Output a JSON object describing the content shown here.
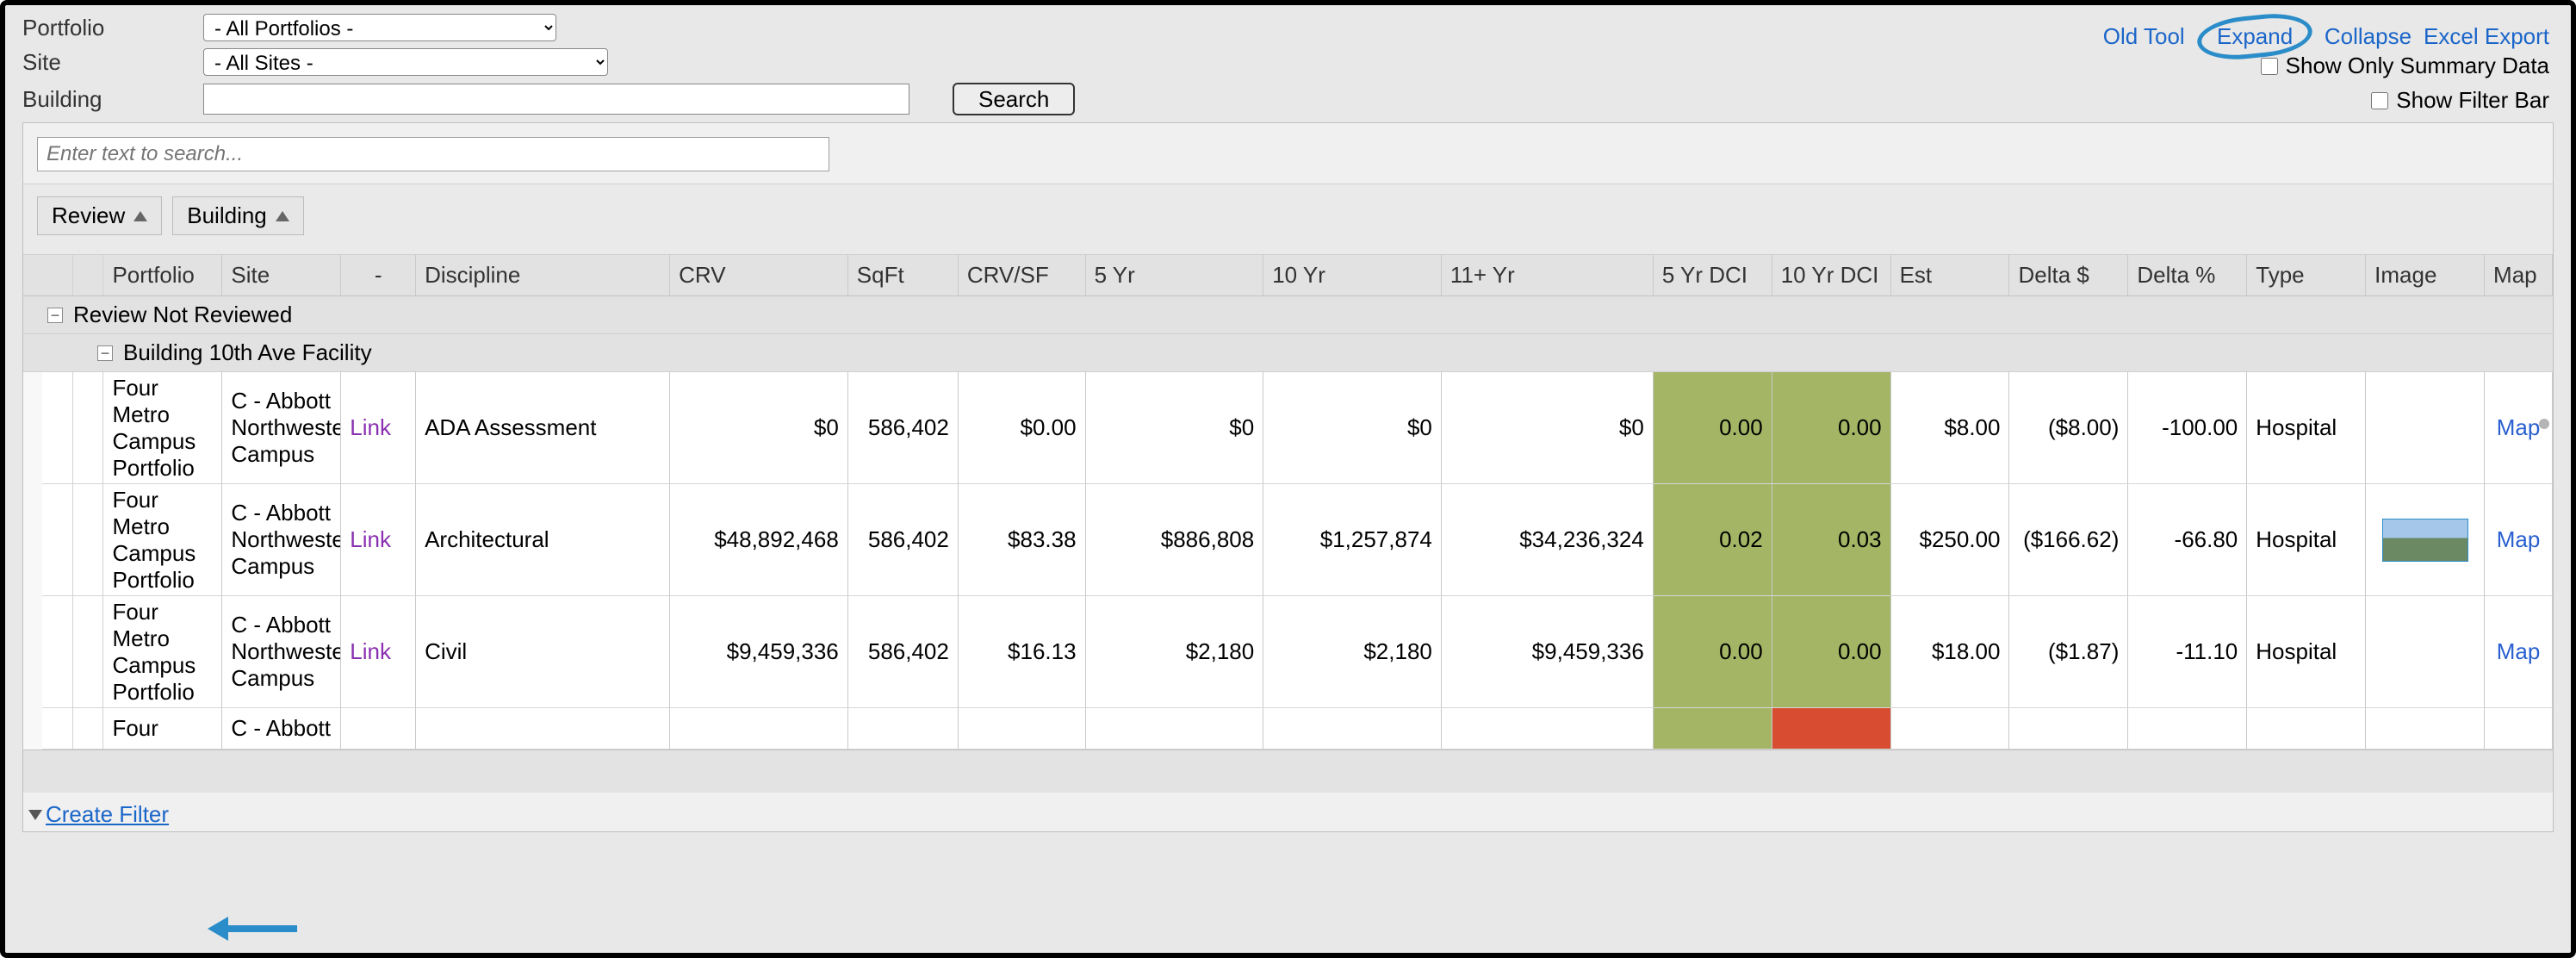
{
  "filters": {
    "portfolio_label": "Portfolio",
    "portfolio_value": "- All Portfolios -",
    "site_label": "Site",
    "site_value": "- All Sites -",
    "building_label": "Building",
    "search_button": "Search"
  },
  "top_links": {
    "old_tool": "Old Tool",
    "expand": "Expand",
    "collapse": "Collapse",
    "excel_export": "Excel Export"
  },
  "checkboxes": {
    "summary_label": "Show Only Summary Data",
    "filterbar_label": "Show Filter Bar"
  },
  "grid": {
    "search_placeholder": "Enter text to search...",
    "group_chips": {
      "review": "Review",
      "building": "Building"
    },
    "headers": {
      "portfolio": "Portfolio",
      "site": "Site",
      "link": "-",
      "discipline": "Discipline",
      "crv": "CRV",
      "sqft": "SqFt",
      "crvsf": "CRV/SF",
      "yr5": "5 Yr",
      "yr10": "10 Yr",
      "yr11": "11+ Yr",
      "dci5": "5 Yr DCI",
      "dci10": "10 Yr DCI",
      "est": "Est",
      "delta": "Delta $",
      "deltapct": "Delta %",
      "type": "Type",
      "image": "Image",
      "map": "Map"
    },
    "group1_label": "Review Not Reviewed",
    "group2_label": "Building 10th Ave Facility",
    "rows": [
      {
        "portfolio": "Four Metro Campus Portfolio",
        "site": "C - Abbott Northwestern Campus",
        "link": "Link",
        "discipline": "ADA Assessment",
        "crv": "$0",
        "sqft": "586,402",
        "crvsf": "$0.00",
        "yr5": "$0",
        "yr10": "$0",
        "yr11": "$0",
        "dci5": "0.00",
        "dci10": "0.00",
        "dci5_class": "dci-green",
        "dci10_class": "dci-green",
        "est": "$8.00",
        "delta": "($8.00)",
        "deltapct": "-100.00",
        "type": "Hospital",
        "has_image": false,
        "map": "Map"
      },
      {
        "portfolio": "Four Metro Campus Portfolio",
        "site": "C - Abbott Northwestern Campus",
        "link": "Link",
        "discipline": "Architectural",
        "crv": "$48,892,468",
        "sqft": "586,402",
        "crvsf": "$83.38",
        "yr5": "$886,808",
        "yr10": "$1,257,874",
        "yr11": "$34,236,324",
        "dci5": "0.02",
        "dci10": "0.03",
        "dci5_class": "dci-green",
        "dci10_class": "dci-green",
        "est": "$250.00",
        "delta": "($166.62)",
        "deltapct": "-66.80",
        "type": "Hospital",
        "has_image": true,
        "map": "Map"
      },
      {
        "portfolio": "Four Metro Campus Portfolio",
        "site": "C - Abbott Northwestern Campus",
        "link": "Link",
        "discipline": "Civil",
        "crv": "$9,459,336",
        "sqft": "586,402",
        "crvsf": "$16.13",
        "yr5": "$2,180",
        "yr10": "$2,180",
        "yr11": "$9,459,336",
        "dci5": "0.00",
        "dci10": "0.00",
        "dci5_class": "dci-green",
        "dci10_class": "dci-green",
        "est": "$18.00",
        "delta": "($1.87)",
        "deltapct": "-11.10",
        "type": "Hospital",
        "has_image": false,
        "map": "Map"
      },
      {
        "portfolio": "Four",
        "site": "C - Abbott",
        "link": "",
        "discipline": "",
        "crv": "",
        "sqft": "",
        "crvsf": "",
        "yr5": "",
        "yr10": "",
        "yr11": "",
        "dci5": "",
        "dci10": "",
        "dci5_class": "dci-green",
        "dci10_class": "dci-red",
        "est": "",
        "delta": "",
        "deltapct": "",
        "type": "",
        "has_image": false,
        "map": ""
      }
    ]
  },
  "footer": {
    "create_filter": "Create Filter"
  }
}
